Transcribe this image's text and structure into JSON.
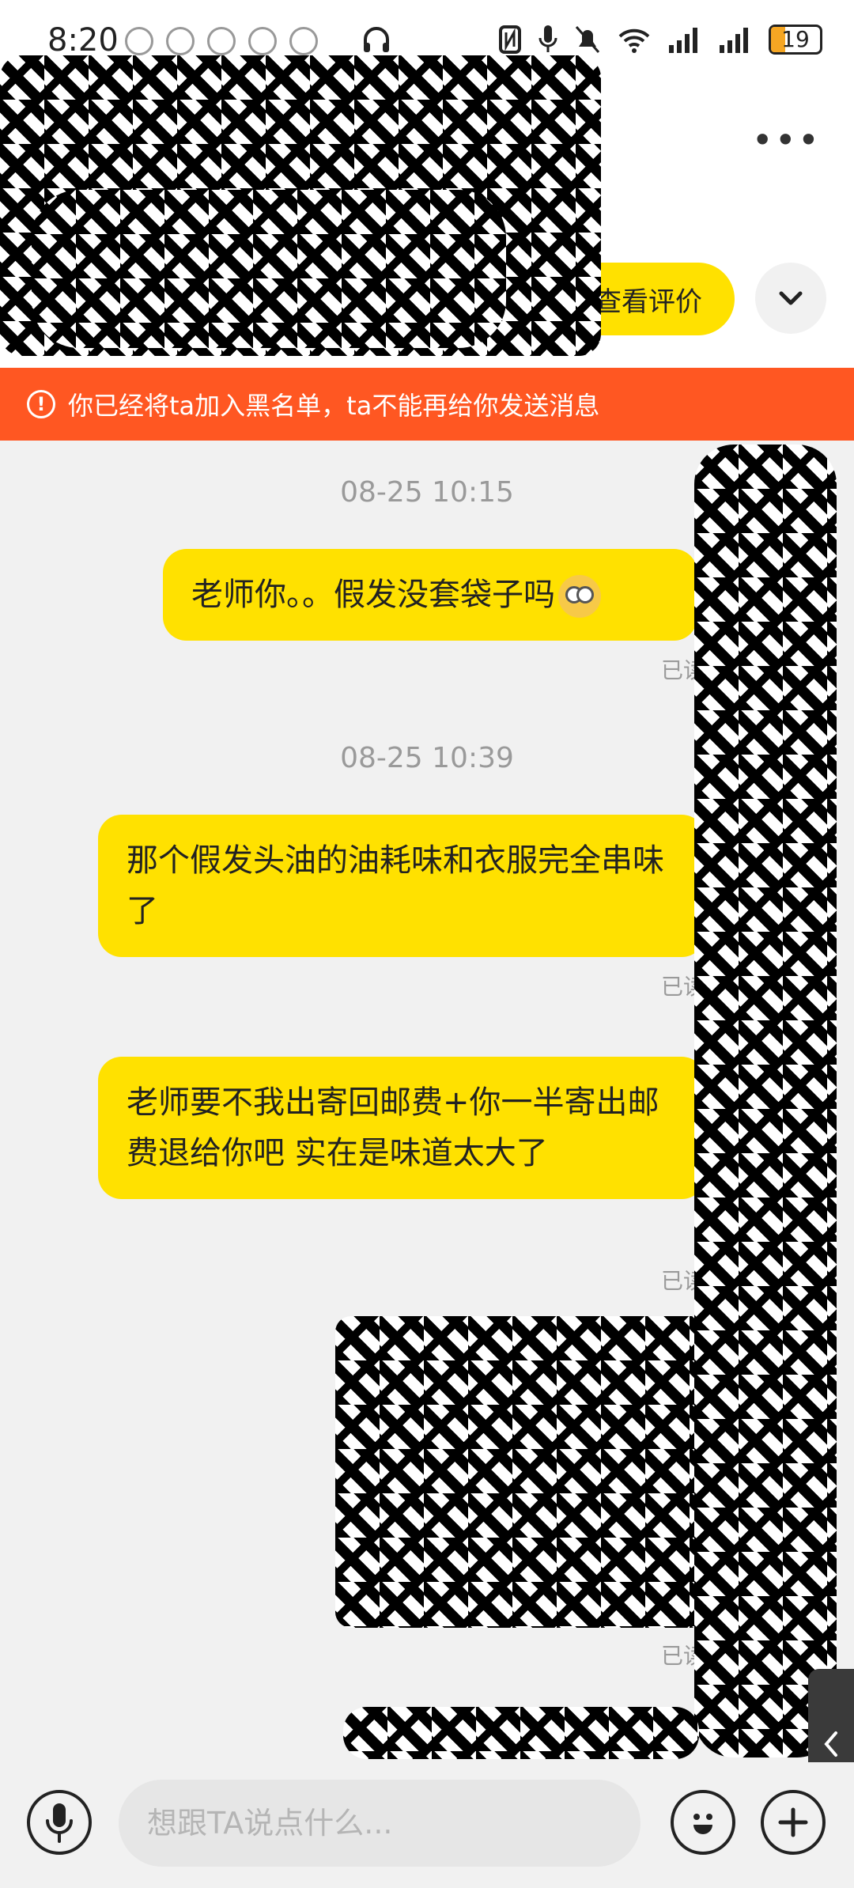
{
  "status_bar": {
    "time": "8:20",
    "battery": "19"
  },
  "header": {
    "more_label": "•••",
    "review_button": "查看评价"
  },
  "banner": {
    "text": "你已经将ta加入黑名单，ta不能再给你发送消息"
  },
  "chat": {
    "messages": [
      {
        "timestamp": "08-25 10:15",
        "text": "老师你。。假发没套袋子吗",
        "status": "已读"
      },
      {
        "timestamp": "08-25 10:39",
        "text": "那个假发头油的油耗味和衣服完全串味了",
        "status": "已读"
      },
      {
        "timestamp": "",
        "text": "老师要不我出寄回邮费+你一半寄出邮费退给你吧 实在是味道太大了",
        "status": "已读"
      },
      {
        "timestamp": "",
        "text": "",
        "status": "已读"
      }
    ]
  },
  "input_bar": {
    "placeholder": "想跟TA说点什么..."
  },
  "icons": {
    "headphone": "headphone-icon",
    "more": "more-icon",
    "chevron": "chevron-down-icon",
    "warning": "warning-icon",
    "voice": "microphone-icon",
    "emoji": "emoji-icon",
    "plus": "plus-icon",
    "side": "chevron-left-icon"
  },
  "colors": {
    "accent": "#ffe100",
    "banner": "#ff5722"
  }
}
